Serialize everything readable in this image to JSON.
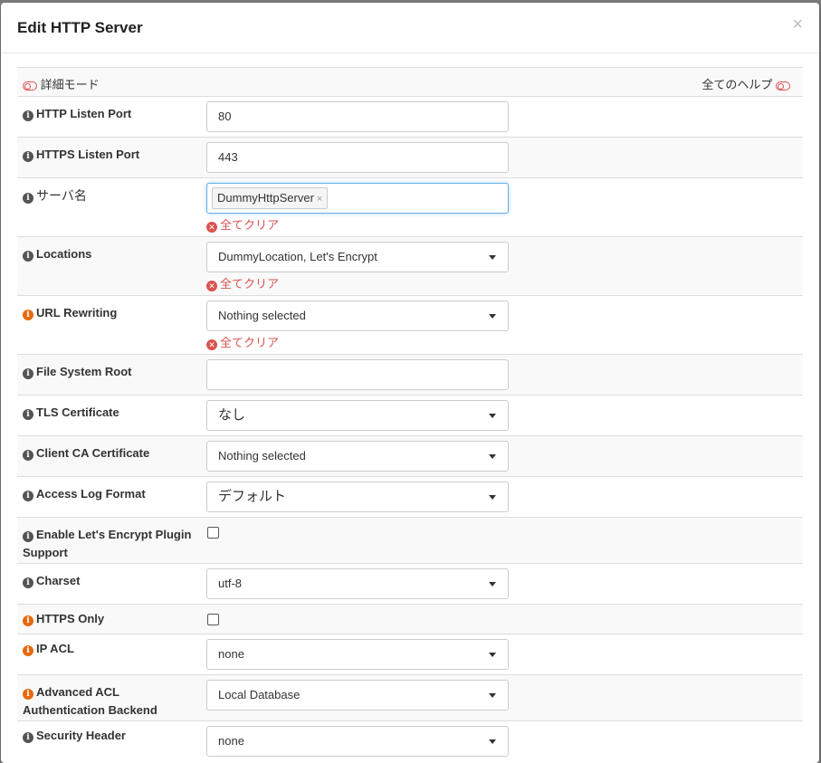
{
  "modal": {
    "title": "Edit HTTP Server",
    "close_label": "×"
  },
  "toolbar": {
    "advanced_mode": "詳細モード",
    "all_help": "全てのヘルプ"
  },
  "clear_all_label": "全てクリア",
  "fields": {
    "http_listen_port": {
      "label": "HTTP Listen Port",
      "value": "80"
    },
    "https_listen_port": {
      "label": "HTTPS Listen Port",
      "value": "443"
    },
    "server_name": {
      "label": "サーバ名",
      "tag": "DummyHttpServer",
      "tag_remove": "×"
    },
    "locations": {
      "label": "Locations",
      "value": "DummyLocation, Let's Encrypt"
    },
    "url_rewriting": {
      "label": "URL Rewriting",
      "value": "Nothing selected"
    },
    "file_system_root": {
      "label": "File System Root",
      "value": ""
    },
    "tls_certificate": {
      "label": "TLS Certificate",
      "value": "なし"
    },
    "client_ca_certificate": {
      "label": "Client CA Certificate",
      "value": "Nothing selected"
    },
    "access_log_format": {
      "label": "Access Log Format",
      "value": "デフォルト"
    },
    "enable_letsencrypt": {
      "label": "Enable Let's Encrypt Plugin Support",
      "checked": false
    },
    "charset": {
      "label": "Charset",
      "value": "utf-8"
    },
    "https_only": {
      "label": "HTTPS Only",
      "checked": false
    },
    "ip_acl": {
      "label": "IP ACL",
      "value": "none"
    },
    "advanced_acl_backend": {
      "label": "Advanced ACL Authentication Backend",
      "value": "Local Database"
    },
    "security_header": {
      "label": "Security Header",
      "value": "none"
    }
  },
  "colors": {
    "info_icon": "#555555",
    "info_icon_highlight": "#e6690f",
    "clear_all": "#d9534f",
    "focus_border": "#66afe9"
  }
}
